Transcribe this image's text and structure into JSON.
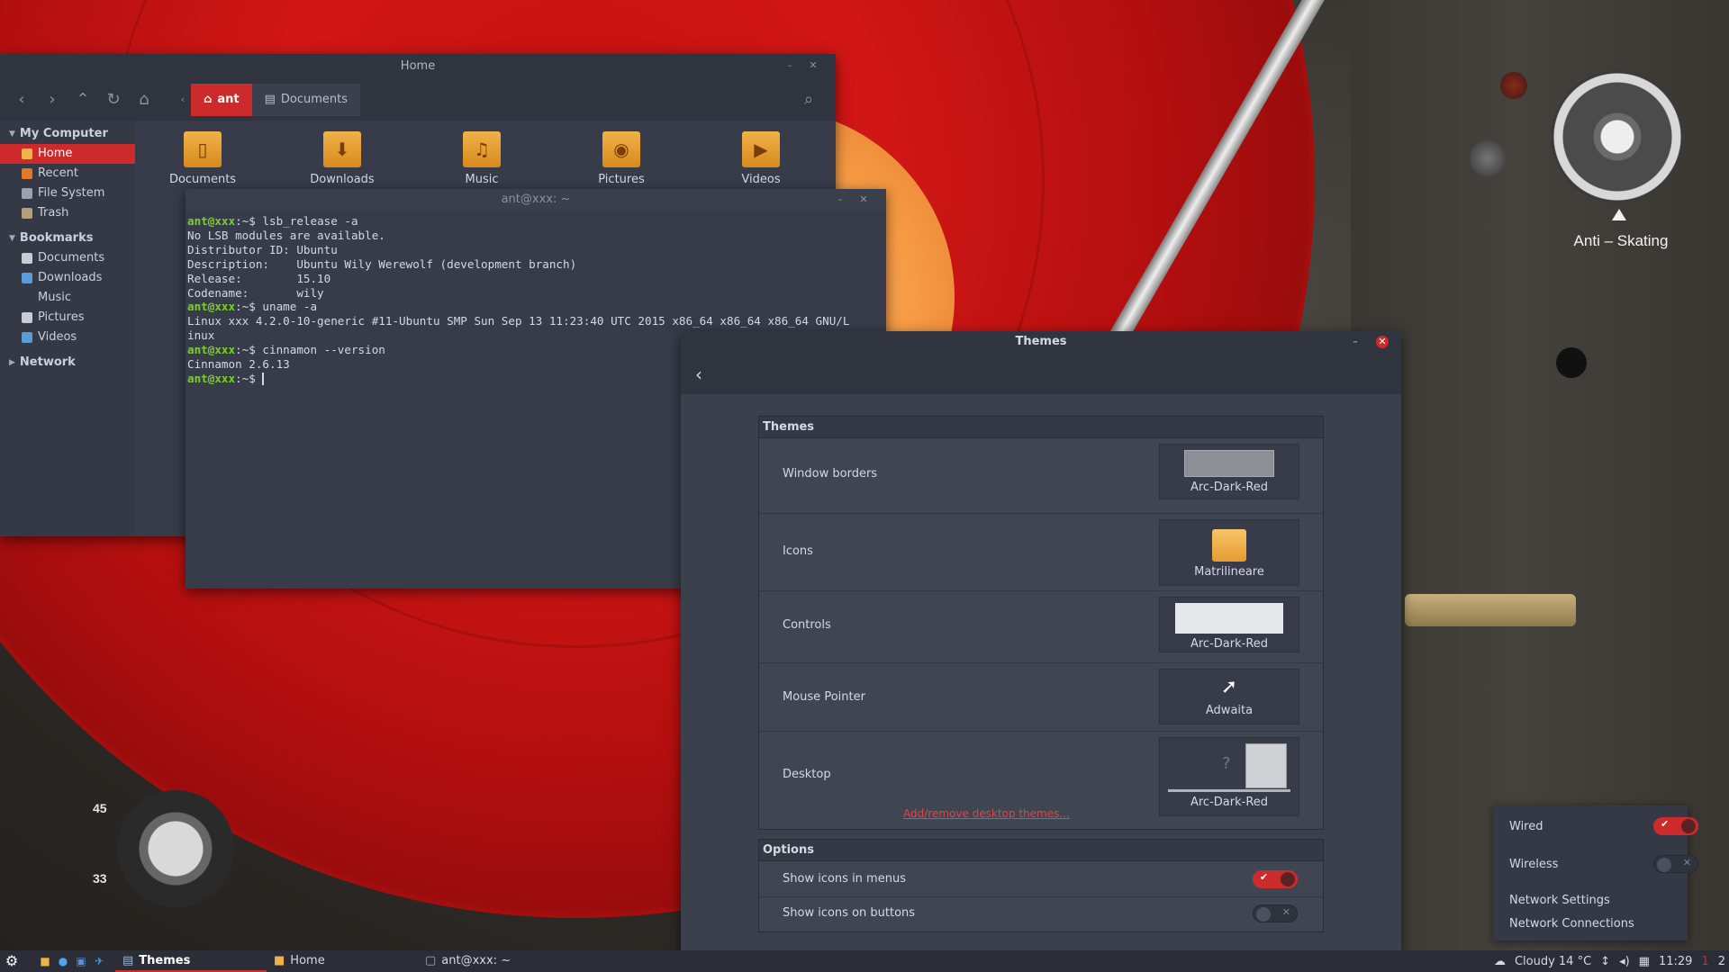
{
  "wallpaper": {
    "dial_label": "Anti – Skating",
    "speed_45": "45",
    "speed_33": "33"
  },
  "file_manager": {
    "title": "Home",
    "crumbs": [
      "ant",
      "Documents"
    ],
    "sidebar": {
      "my_computer": "My Computer",
      "computer_items": [
        "Home",
        "Recent",
        "File System",
        "Trash"
      ],
      "bookmarks": "Bookmarks",
      "bookmark_items": [
        "Documents",
        "Downloads",
        "Music",
        "Pictures",
        "Videos"
      ],
      "network": "Network"
    },
    "files": [
      "Documents",
      "Downloads",
      "Music",
      "Pictures",
      "Videos"
    ]
  },
  "terminal": {
    "title": "ant@xxx: ~",
    "prompt": "ant@xxx",
    "lines": [
      {
        "type": "cmd",
        "text": ":~$ lsb_release -a"
      },
      {
        "type": "out",
        "text": "No LSB modules are available."
      },
      {
        "type": "out",
        "text": "Distributor ID: Ubuntu"
      },
      {
        "type": "out",
        "text": "Description:    Ubuntu Wily Werewolf (development branch)"
      },
      {
        "type": "out",
        "text": "Release:        15.10"
      },
      {
        "type": "out",
        "text": "Codename:       wily"
      },
      {
        "type": "cmd",
        "text": ":~$ uname -a"
      },
      {
        "type": "out",
        "text": "Linux xxx 4.2.0-10-generic #11-Ubuntu SMP Sun Sep 13 11:23:40 UTC 2015 x86_64 x86_64 x86_64 GNU/L"
      },
      {
        "type": "out",
        "text": "inux"
      },
      {
        "type": "cmd",
        "text": ":~$ cinnamon --version"
      },
      {
        "type": "out",
        "text": "Cinnamon 2.6.13"
      },
      {
        "type": "cmd",
        "text": ":~$ "
      }
    ]
  },
  "themes": {
    "title": "Themes",
    "section_themes": "Themes",
    "rows": [
      {
        "label": "Window borders",
        "value": "Arc-Dark-Red"
      },
      {
        "label": "Icons",
        "value": "Matrilineare"
      },
      {
        "label": "Controls",
        "value": "Arc-Dark-Red"
      },
      {
        "label": "Mouse Pointer",
        "value": "Adwaita"
      },
      {
        "label": "Desktop",
        "value": "Arc-Dark-Red"
      }
    ],
    "desktop_link": "Add/remove desktop themes...",
    "section_options": "Options",
    "options": [
      {
        "label": "Show icons in menus",
        "on": true
      },
      {
        "label": "Show icons on buttons",
        "on": false
      }
    ]
  },
  "network_menu": {
    "wired": "Wired",
    "wired_on": true,
    "wireless": "Wireless",
    "wireless_on": false,
    "settings": "Network Settings",
    "connections": "Network Connections"
  },
  "panel": {
    "tasks": [
      "Themes",
      "Home",
      "ant@xxx: ~"
    ],
    "weather": "Cloudy 14 °C",
    "clock": "11:29",
    "badge1": "1",
    "badge2": "2"
  },
  "colors": {
    "accent": "#cd2b2b",
    "prompt": "#79d02e",
    "window_bg": "#383c4a",
    "title_bg": "#2f343f"
  }
}
